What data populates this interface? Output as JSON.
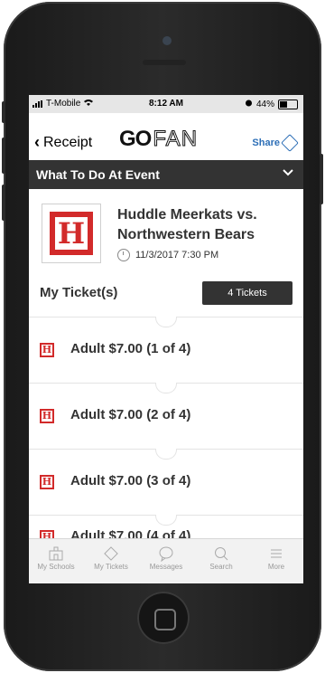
{
  "status": {
    "carrier": "T-Mobile",
    "time": "8:12 AM",
    "battery": "44%"
  },
  "nav": {
    "back_label": "Receipt",
    "logo_go": "GO",
    "logo_fan": "FAN",
    "share_label": "Share"
  },
  "banner": {
    "title": "What To Do At Event"
  },
  "event": {
    "logo_letter": "H",
    "name": "Huddle Meerkats vs. Northwestern Bears",
    "datetime": "11/3/2017 7:30 PM"
  },
  "tickets": {
    "header": "My Ticket(s)",
    "count_label": "4 Tickets",
    "items": [
      {
        "label": "Adult $7.00 (1 of 4)"
      },
      {
        "label": "Adult $7.00 (2 of 4)"
      },
      {
        "label": "Adult $7.00 (3 of 4)"
      },
      {
        "label": "Adult $7.00 (4 of 4)"
      }
    ]
  },
  "tabbar": {
    "items": [
      {
        "label": "My Schools",
        "icon": "school-icon"
      },
      {
        "label": "My Tickets",
        "icon": "ticket-icon"
      },
      {
        "label": "Messages",
        "icon": "chat-icon"
      },
      {
        "label": "Search",
        "icon": "search-icon"
      },
      {
        "label": "More",
        "icon": "menu-icon"
      }
    ]
  }
}
